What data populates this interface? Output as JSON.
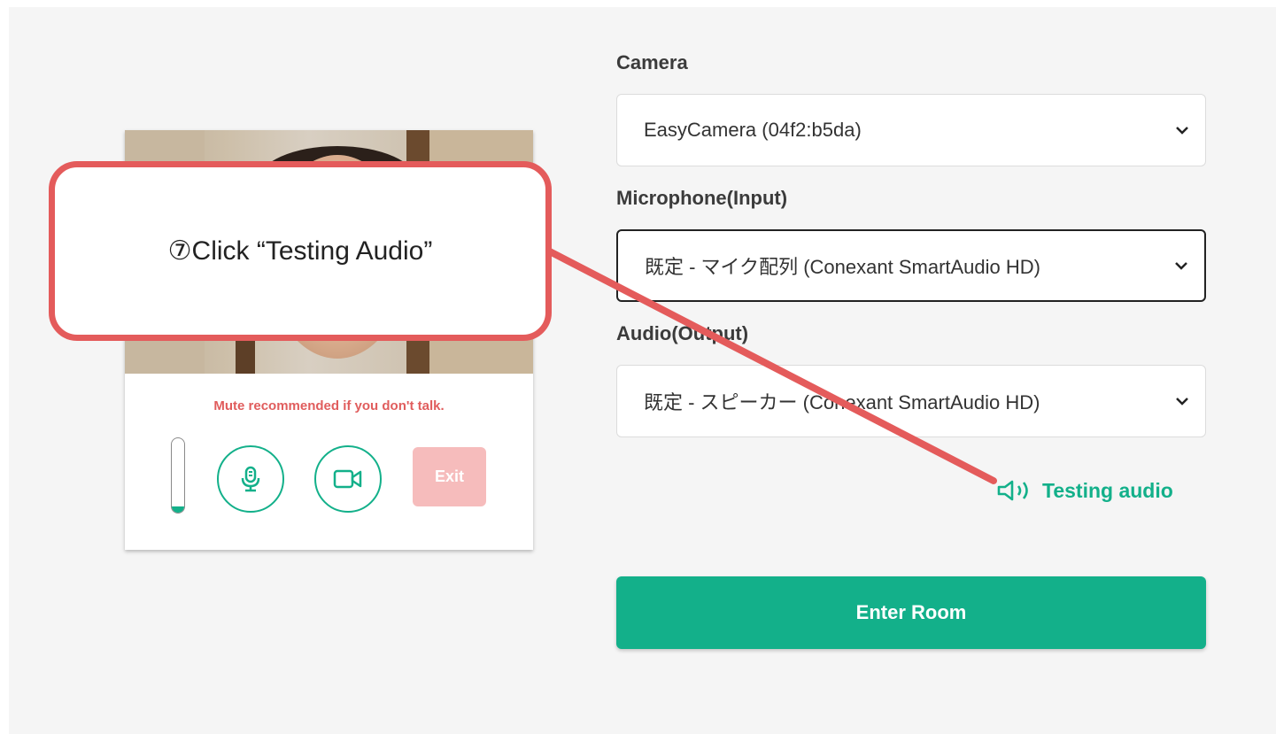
{
  "preview": {
    "mute_note": "Mute recommended if you don't talk.",
    "level_fraction": 0.08,
    "mic_button_icon": "microphone-icon",
    "camera_button_icon": "video-camera-icon",
    "exit_label": "Exit"
  },
  "form": {
    "camera": {
      "label": "Camera",
      "value": "EasyCamera (04f2:b5da)"
    },
    "microphone": {
      "label": "Microphone(Input)",
      "value": "既定 - マイク配列 (Conexant SmartAudio HD)"
    },
    "audio": {
      "label": "Audio(Output)",
      "value": "既定 - スピーカー (Conexant SmartAudio HD)"
    },
    "testing_audio_label": "Testing audio",
    "testing_audio_icon": "speaker-icon",
    "enter_room_label": "Enter Room"
  },
  "callout": {
    "text": "⑦Click “Testing Audio”"
  },
  "colors": {
    "accent": "#13b08a",
    "warning": "#e05d5d",
    "exit_disabled": "#f6bcbc",
    "callout_border": "#e45b5b"
  }
}
